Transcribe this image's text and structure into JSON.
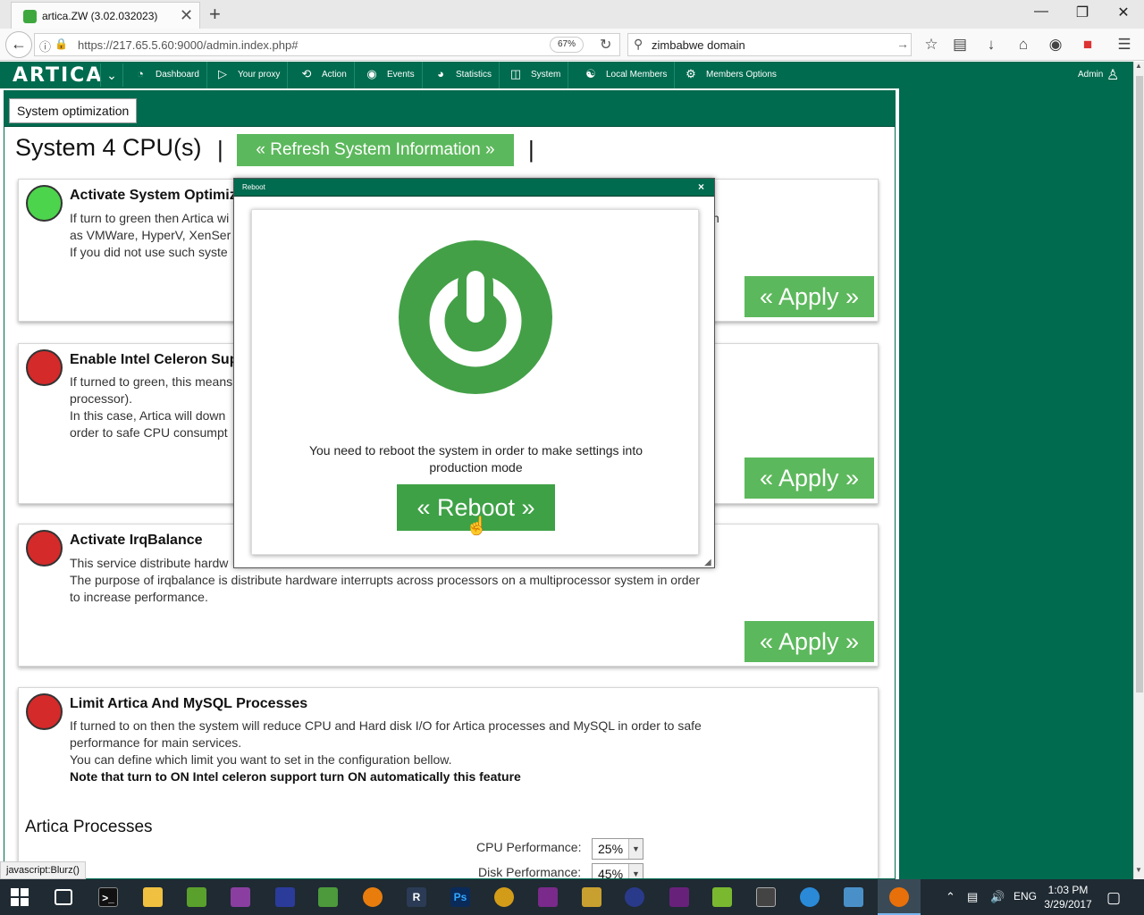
{
  "browser": {
    "tab_title": "artica.ZW (3.02.032023)",
    "tab_close": "✕",
    "new_tab": "+",
    "url": "https://217.65.5.60:9000/admin.index.php#",
    "zoom": "67%",
    "search_query": "zimbabwe domain",
    "status_text": "javascript:Blurz()"
  },
  "app": {
    "logo": "ARTICA",
    "nav": [
      {
        "label": "Dashboard"
      },
      {
        "label": "Your proxy"
      },
      {
        "label": "Action"
      },
      {
        "label": "Events"
      },
      {
        "label": "Statistics"
      },
      {
        "label": "System"
      },
      {
        "label": "Local Members"
      },
      {
        "label": "Members Options"
      }
    ],
    "user": "Admin"
  },
  "page": {
    "tab": "System optimization",
    "title": "System 4 CPU(s)",
    "separator": "|",
    "refresh_button": "« Refresh System Information »",
    "apply_label": "« Apply »",
    "cards": [
      {
        "title": "Activate System Optimiz",
        "status": "green",
        "lines": [
          "If turn to green then Artica wi",
          "as VMWare, HyperV, XenSer",
          "If you did not use such syste"
        ],
        "right_fragment": "n"
      },
      {
        "title": "Enable Intel Celeron Sup",
        "status": "red",
        "lines": [
          "If turned to green, this means",
          "processor).",
          "In this case, Artica will down",
          "order to safe CPU consumpt"
        ]
      },
      {
        "title": "Activate IrqBalance",
        "status": "red",
        "lines": [
          "This service distribute hardw",
          "The purpose of irqbalance is distribute hardware interrupts across processors on a multiprocessor system in order",
          "to increase performance."
        ]
      },
      {
        "title": "Limit Artica And MySQL Processes",
        "status": "red",
        "lines": [
          "If turned to on then the system will reduce CPU and Hard disk I/O for Artica processes and MySQL in order to safe",
          "performance for main services.",
          "You can define which limit you want to set in the configuration bellow."
        ],
        "note": "Note that turn to ON Intel celeron support turn ON automatically this feature"
      }
    ],
    "processes_title": "Artica Processes",
    "cpu_perf_label": "CPU Performance:",
    "cpu_perf_value": "25%",
    "disk_perf_label": "Disk Performance:",
    "disk_perf_value": "45%"
  },
  "modal": {
    "title": "Reboot",
    "close": "×",
    "message_line1": "You need to reboot the system in order to make settings into",
    "message_line2": "production mode",
    "button": "« Reboot »",
    "icon_color": "#43a047"
  },
  "taskbar": {
    "language": "ENG",
    "time": "1:03 PM",
    "date": "3/29/2017"
  },
  "colors": {
    "brand_green": "#006b4f",
    "button_green": "#5cb85c",
    "status_green": "#4cd44c",
    "status_red": "#d42a2a"
  }
}
